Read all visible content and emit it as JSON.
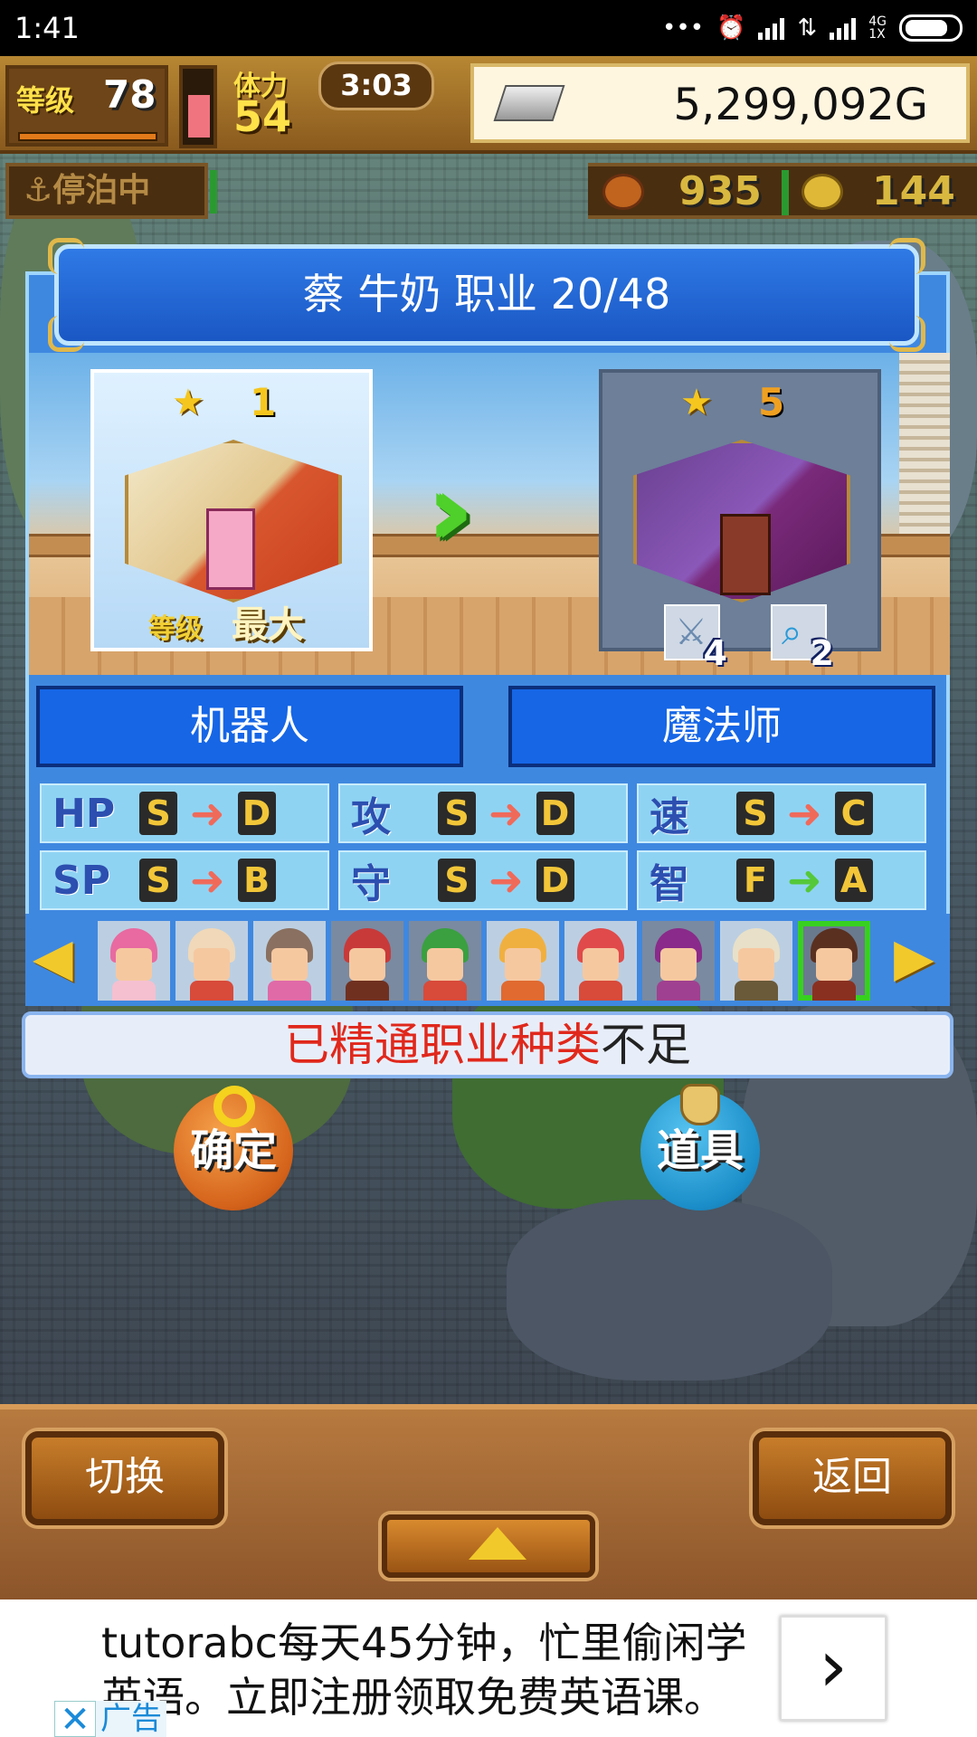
{
  "status_bar": {
    "time": "1:41",
    "icons": [
      "more-dots-icon",
      "alarm-icon",
      "signal-icon",
      "data-arrows-icon",
      "signal-4g-icon",
      "battery-icon"
    ],
    "network_label": "4G",
    "sim_label": "1X"
  },
  "hud": {
    "level_label": "等级",
    "level_value": "78",
    "stamina_label": "体力",
    "stamina_value": "54",
    "stamina_fill": 0.65,
    "timer": "3:03",
    "gold": "5,299,092G",
    "dock_status": "停泊中",
    "food_count": "935",
    "medal_count": "144"
  },
  "dialog": {
    "title": "蔡 牛奶  职业 20/48",
    "from_card": {
      "stars": "1",
      "level_label": "等级",
      "level_value": "最大"
    },
    "to_card": {
      "stars": "5",
      "items": [
        {
          "icon": "sword-icon",
          "count": "4"
        },
        {
          "icon": "magnifier-icon",
          "count": "2"
        }
      ]
    },
    "from_class": "机器人",
    "to_class": "魔法师",
    "stats": [
      {
        "label": "HP",
        "from": "S",
        "to": "D",
        "arrow_color": "#f06a5a"
      },
      {
        "label": "攻",
        "from": "S",
        "to": "D",
        "arrow_color": "#f06a5a"
      },
      {
        "label": "速",
        "from": "S",
        "to": "C",
        "arrow_color": "#f06a5a"
      },
      {
        "label": "SP",
        "from": "S",
        "to": "B",
        "arrow_color": "#f06a5a"
      },
      {
        "label": "守",
        "from": "S",
        "to": "D",
        "arrow_color": "#f06a5a"
      },
      {
        "label": "智",
        "from": "F",
        "to": "A",
        "arrow_color": "#55c83a"
      }
    ],
    "message_red": "已精通职业种类",
    "message_dark": "不足"
  },
  "portraits": [
    {
      "hair": "#e86aa0",
      "body": "#f5c0d0",
      "bg": "#bccfe2",
      "selected": false
    },
    {
      "hair": "#f0d8b8",
      "body": "#d84a3a",
      "bg": "#bccfe2",
      "selected": false
    },
    {
      "hair": "#8a7060",
      "body": "#e06aa8",
      "bg": "#bccfe2",
      "selected": false
    },
    {
      "hair": "#c83a3a",
      "body": "#703020",
      "bg": "#7a8aa0",
      "selected": false
    },
    {
      "hair": "#3aa040",
      "body": "#d84a3a",
      "bg": "#7a8aa0",
      "selected": false
    },
    {
      "hair": "#f0b040",
      "body": "#e06a30",
      "bg": "#bccfe2",
      "selected": false
    },
    {
      "hair": "#e04a4a",
      "body": "#d84a3a",
      "bg": "#bccfe2",
      "selected": false
    },
    {
      "hair": "#8a2a8a",
      "body": "#a04090",
      "bg": "#7a8aa0",
      "selected": false
    },
    {
      "hair": "#e8e0c8",
      "body": "#6a5a3a",
      "bg": "#bccfe2",
      "selected": false
    },
    {
      "hair": "#5a3020",
      "body": "#8a3020",
      "bg": "#6a7a8e",
      "selected": true
    }
  ],
  "buttons": {
    "confirm": "确定",
    "items": "道具",
    "switch": "切换",
    "back": "返回"
  },
  "ad": {
    "text": "tutorabc每天45分钟，忙里偷闲学英语。立即注册领取免费英语课。",
    "tag": "广告",
    "close_icon": "close-icon",
    "arrow_icon": "chevron-right-icon"
  },
  "colors": {
    "accent_blue": "#1666e6",
    "message_red": "#e0281c",
    "selected_border": "#38d020"
  }
}
